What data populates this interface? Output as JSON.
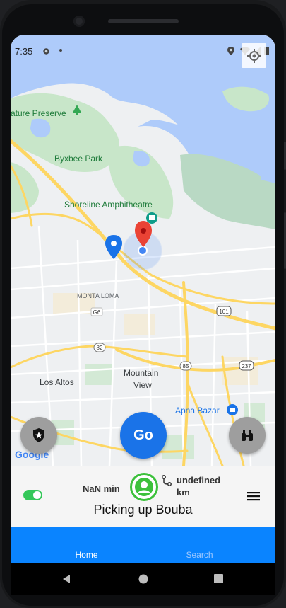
{
  "status": {
    "time": "7:35"
  },
  "map": {
    "places": {
      "nature_preserve": "ature Preserve",
      "byxbee": "Byxbee Park",
      "shoreline": "Shoreline Amphitheatre",
      "monta_loma": "MONTA LOMA",
      "los_altos": "Los Altos",
      "mountain_view_1": "Mountain",
      "mountain_view_2": "View",
      "apna_bazar": "Apna Bazar"
    },
    "road_badges": {
      "g6": "G6",
      "r82": "82",
      "r85": "85",
      "r101": "101",
      "r237": "237"
    },
    "attribution": "Google"
  },
  "actions": {
    "go": "Go"
  },
  "panel": {
    "duration": "NaN min",
    "distance_line1": "undefined",
    "distance_line2": "km",
    "status_text": "Picking up Bouba"
  },
  "bottom_nav": {
    "home": "Home",
    "search": "Search"
  },
  "colors": {
    "accent": "#1a73e8",
    "nav_bg": "#0a84ff",
    "toggle": "#34c759",
    "avatar_ring": "#3cc13b"
  }
}
